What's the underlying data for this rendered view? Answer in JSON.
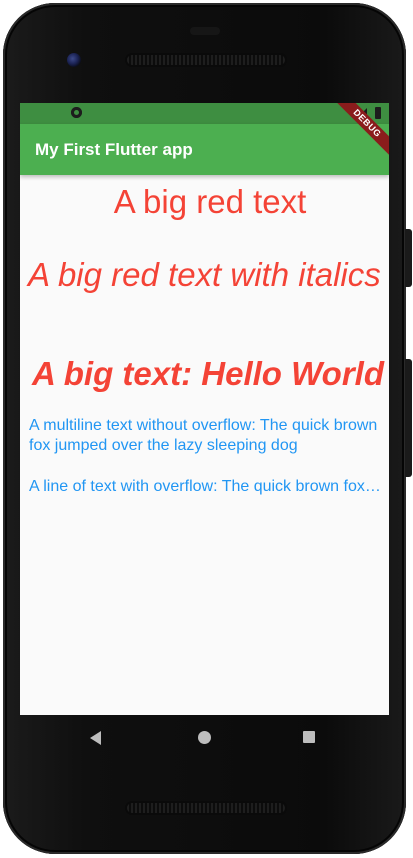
{
  "app_bar": {
    "title": "My First Flutter app",
    "background_color": "#4caf50",
    "status_bar_color": "#3e8e41",
    "debug_banner": "DEBUG"
  },
  "content": {
    "big_red_text": "A big red text",
    "big_red_italic_text": "A big red text with italics",
    "big_bold_text": "A big text: Hello World",
    "multiline_text": "A multiline text without overflow: The quick brown fox jumped over the lazy sleeping dog",
    "overflow_text": "A line of text with overflow:  The quick brown fox jumped over the lazy sleeping dog",
    "red_color": "#f44336",
    "blue_color": "#2196f3"
  },
  "status_bar": {
    "left_icon": "sync-icon",
    "signal_icon": "signal-icon",
    "battery_icon": "battery-icon"
  },
  "nav_bar": {
    "back_icon": "back-icon",
    "home_icon": "home-icon",
    "recent_icon": "recent-apps-icon"
  }
}
